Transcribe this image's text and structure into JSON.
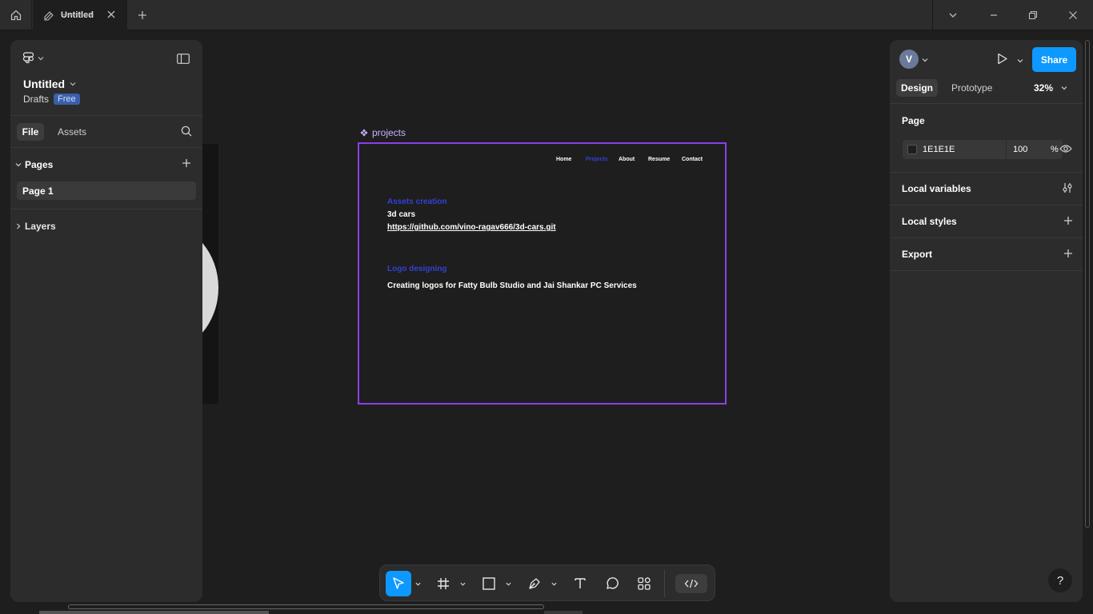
{
  "titlebar": {
    "tab_title": "Untitled",
    "icons": [
      "home-icon",
      "file-icon",
      "close-icon",
      "plus-icon",
      "chevron-down-icon",
      "minimize-icon",
      "restore-icon",
      "window-close-icon"
    ]
  },
  "left_panel": {
    "file_name": "Untitled",
    "drafts_label": "Drafts",
    "plan_badge": "Free",
    "tabs": {
      "file": "File",
      "assets": "Assets"
    },
    "pages_heading": "Pages",
    "pages": [
      {
        "label": "Page 1"
      }
    ],
    "layers_heading": "Layers"
  },
  "canvas": {
    "frame_label": "projects",
    "frame_color": "#8c3fe8",
    "nav": [
      "Home",
      "Projects",
      "About",
      "Resume",
      "Contact"
    ],
    "nav_active": "Projects",
    "sections": [
      {
        "title": "Assets creation",
        "lines": [
          "3d cars",
          "https://github.com/vino-ragav666/3d-cars.git"
        ]
      },
      {
        "title": "Logo designing",
        "lines": [
          "Creating logos for Fatty Bulb Studio and Jai Shankar PC Services"
        ]
      }
    ],
    "accent": "#3340d6"
  },
  "right_panel": {
    "avatar_initial": "V",
    "share_label": "Share",
    "tabs": {
      "design": "Design",
      "prototype": "Prototype"
    },
    "zoom": "32%",
    "page_heading": "Page",
    "page_color": "1E1E1E",
    "page_opacity": "100",
    "percent_sign": "%",
    "rows": [
      "Local variables",
      "Local styles",
      "Export"
    ],
    "share_color": "#0d99ff"
  },
  "help": "?"
}
